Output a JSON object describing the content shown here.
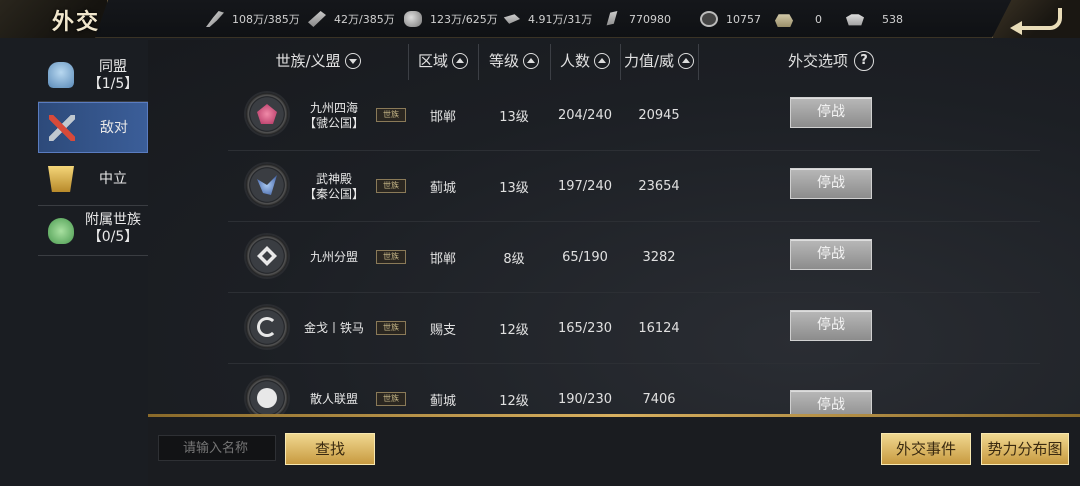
{
  "title": "外交",
  "resources": [
    {
      "icon": "grain-icon",
      "value": "108万/385万"
    },
    {
      "icon": "wood-icon",
      "value": "42万/385万"
    },
    {
      "icon": "stone-icon",
      "value": "123万/625万"
    },
    {
      "icon": "iron-icon",
      "value": "4.91万/31万"
    },
    {
      "icon": "book-icon",
      "value": "770980"
    },
    {
      "icon": "coin-icon",
      "value": "10757"
    },
    {
      "icon": "gold-ingot-icon",
      "value": "0"
    },
    {
      "icon": "silver-icon",
      "value": "538"
    }
  ],
  "sidebar": {
    "items": [
      {
        "label": "同盟",
        "sub": "【1/5】",
        "icon": "ally-icon"
      },
      {
        "label": "敌对",
        "sub": "",
        "icon": "enemy-icon"
      },
      {
        "label": "中立",
        "sub": "",
        "icon": "neutral-icon"
      },
      {
        "label": "附属世族",
        "sub": "【0/5】",
        "icon": "vassal-icon"
      }
    ]
  },
  "table": {
    "headers": {
      "clan": "世族/义盟",
      "region": "区域",
      "level": "等级",
      "members": "人数",
      "power": "力值/威",
      "options": "外交选项"
    },
    "tag_label": "世族",
    "action_label": "停战",
    "rows": [
      {
        "name1": "九州四海",
        "name2": "【虢公国】",
        "region": "邯郸",
        "level": "13级",
        "members": "204/240",
        "power": "20945",
        "emblem": "phoenix-emblem-icon"
      },
      {
        "name1": "武神殿",
        "name2": "【秦公国】",
        "region": "蓟城",
        "level": "13级",
        "members": "197/240",
        "power": "23654",
        "emblem": "bird-emblem-icon"
      },
      {
        "name1": "九州分盟",
        "name2": "",
        "region": "邯郸",
        "level": "8级",
        "members": "65/190",
        "power": "3282",
        "emblem": "diamond-emblem-icon"
      },
      {
        "name1": "金戈丨铁马",
        "name2": "",
        "region": "赐支",
        "level": "12级",
        "members": "165/230",
        "power": "16124",
        "emblem": "swirl-emblem-icon"
      },
      {
        "name1": "散人联盟",
        "name2": "",
        "region": "蓟城",
        "level": "12级",
        "members": "190/230",
        "power": "7406",
        "emblem": "seal-emblem-icon"
      }
    ]
  },
  "bottom": {
    "search_placeholder": "请输入名称",
    "search_button": "查找",
    "events_button": "外交事件",
    "map_button": "势力分布图"
  }
}
